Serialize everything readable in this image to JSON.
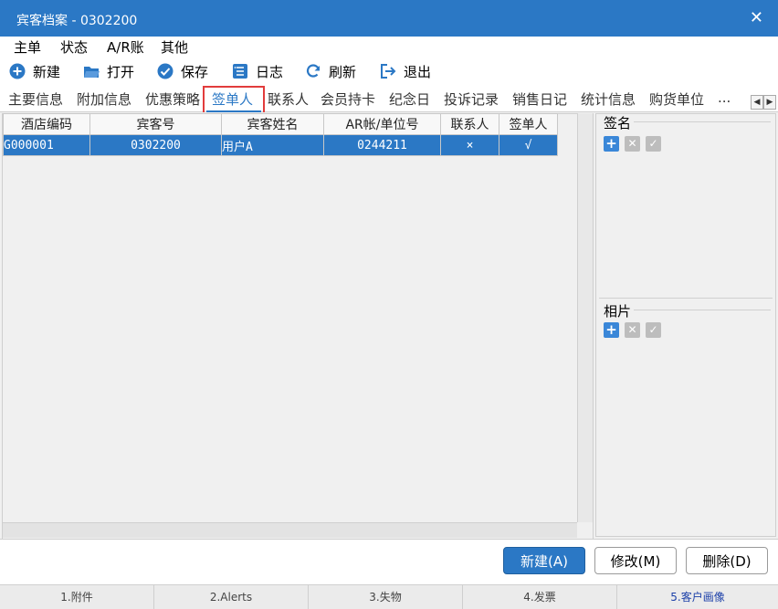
{
  "window": {
    "title": "宾客档案 - 0302200",
    "close": "✕"
  },
  "menu": [
    "主单",
    "状态",
    "A/R账",
    "其他"
  ],
  "toolbar": [
    {
      "label": "新建",
      "icon": "plus-circle-icon"
    },
    {
      "label": "打开",
      "icon": "folder-open-icon"
    },
    {
      "label": "保存",
      "icon": "check-circle-icon"
    },
    {
      "label": "日志",
      "icon": "list-icon"
    },
    {
      "label": "刷新",
      "icon": "refresh-icon"
    },
    {
      "label": "退出",
      "icon": "exit-icon"
    }
  ],
  "tabs": [
    "主要信息",
    "附加信息",
    "优惠策略",
    "签单人",
    "联系人",
    "会员持卡",
    "纪念日",
    "投诉记录",
    "销售日记",
    "统计信息",
    "购货单位",
    "..."
  ],
  "active_tab": "签单人",
  "grid": {
    "columns": [
      "酒店编码",
      "宾客号",
      "宾客姓名",
      "AR帐/单位号",
      "联系人",
      "签单人"
    ],
    "rows": [
      {
        "hotel_code": "G000001",
        "guest_no": "0302200",
        "guest_name": "用户A",
        "ar_unit": "0244211",
        "contact": "×",
        "signer": "√"
      }
    ]
  },
  "right_panel": {
    "signature_label": "签名",
    "photo_label": "相片"
  },
  "buttons": {
    "new": "新建(A)",
    "modify": "修改(M)",
    "delete": "删除(D)"
  },
  "status_tabs": [
    "1.附件",
    "2.Alerts",
    "3.失物",
    "4.发票",
    "5.客户画像"
  ],
  "colors": {
    "accent": "#2b78c5",
    "highlight": "#e23c3c",
    "active_status": "#1b3fa8"
  }
}
